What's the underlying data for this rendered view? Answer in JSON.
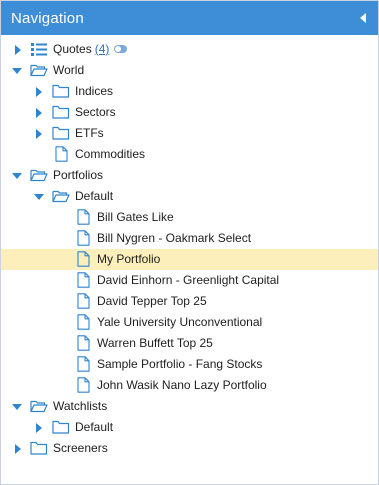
{
  "header": {
    "title": "Navigation"
  },
  "tree": {
    "quotes": {
      "label": "Quotes",
      "count": "(4)"
    },
    "world": {
      "label": "World",
      "indices": "Indices",
      "sectors": "Sectors",
      "etfs": "ETFs",
      "commodities": "Commodities"
    },
    "portfolios": {
      "label": "Portfolios",
      "default": "Default",
      "items": [
        "Bill Gates Like",
        "Bill Nygren - Oakmark Select",
        "My Portfolio",
        "David Einhorn - Greenlight Capital",
        "David Tepper Top 25",
        "Yale University Unconventional",
        "Warren Buffett Top 25",
        "Sample Portfolio - Fang Stocks",
        "John Wasik Nano Lazy Portfolio"
      ]
    },
    "watchlists": {
      "label": "Watchlists",
      "default": "Default"
    },
    "screeners": {
      "label": "Screeners"
    }
  },
  "colors": {
    "header_bg": "#3d8ed6",
    "accent": "#2f84d0",
    "selected_bg": "#fcefbc"
  }
}
